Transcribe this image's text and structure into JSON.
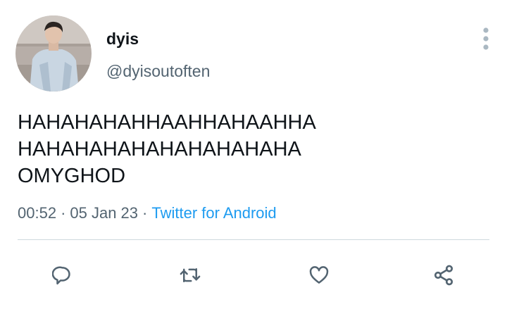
{
  "user": {
    "display_name": "dyis",
    "handle": "@dyisoutoften"
  },
  "tweet": {
    "lines": [
      "HAHAHAHAHHAAHHAHAAHHA",
      "HAHAHAHAHAHAHAHAHAHA",
      "OMYGHOD"
    ],
    "time": "00:52",
    "date": "05 Jan 23",
    "separator": "·",
    "source": "Twitter for Android"
  },
  "icons": {
    "more": "more-vertical-icon",
    "reply": "reply-icon",
    "retweet": "retweet-icon",
    "like": "heart-icon",
    "share": "share-icon"
  },
  "colors": {
    "text": "#0f1419",
    "secondary": "#536471",
    "link": "#1d9bf0",
    "divider": "#cfd9de",
    "icon": "#536471"
  }
}
